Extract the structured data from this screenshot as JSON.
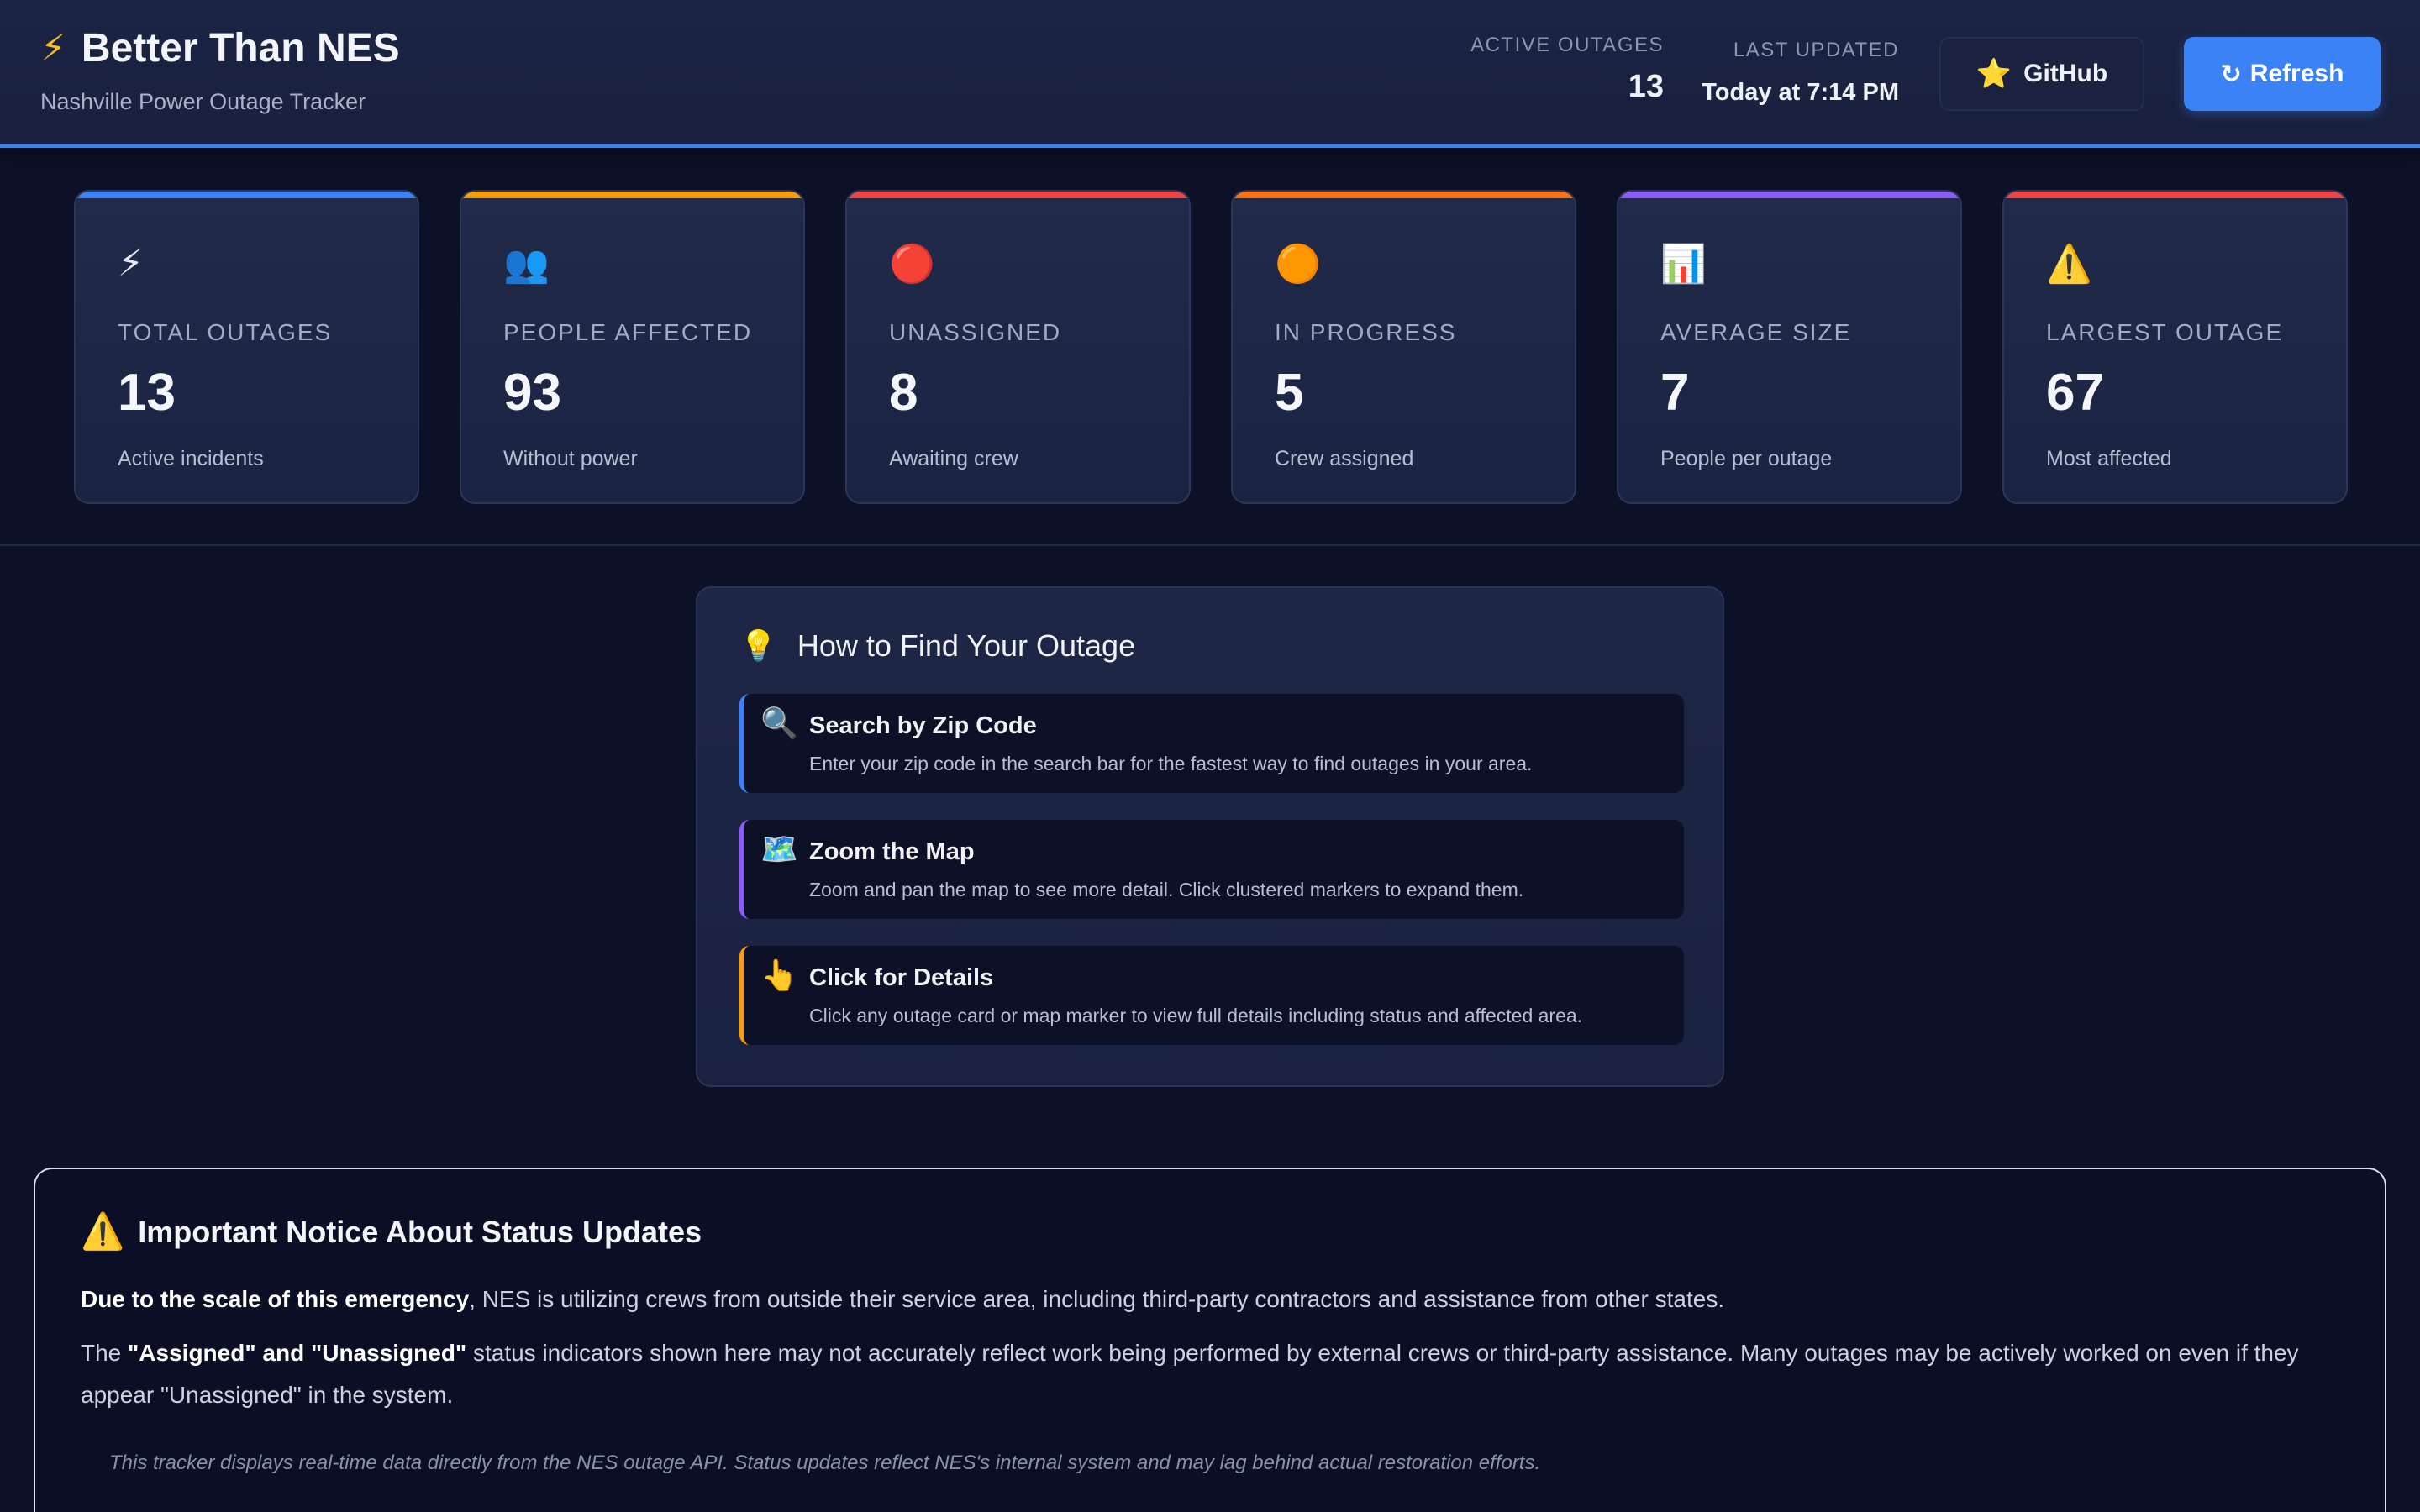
{
  "header": {
    "title": "Better Than NES",
    "title_icon": "⚡",
    "subtitle": "Nashville Power Outage Tracker",
    "active_outages_label": "ACTIVE OUTAGES",
    "active_outages_value": "13",
    "last_updated_label": "LAST UPDATED",
    "last_updated_value": "Today at 7:14 PM",
    "github_icon": "⭐",
    "github_label": "GitHub",
    "refresh_icon": "↻",
    "refresh_label": "Refresh"
  },
  "cards": [
    {
      "icon": "⚡",
      "label": "TOTAL OUTAGES",
      "value": "13",
      "sub": "Active incidents",
      "accent": "#3b82f6"
    },
    {
      "icon": "👥",
      "label": "PEOPLE AFFECTED",
      "value": "93",
      "sub": "Without power",
      "accent": "#f59e0b"
    },
    {
      "icon": "🔴",
      "label": "UNASSIGNED",
      "value": "8",
      "sub": "Awaiting crew",
      "accent": "#ef4444"
    },
    {
      "icon": "🟠",
      "label": "IN PROGRESS",
      "value": "5",
      "sub": "Crew assigned",
      "accent": "#f97316"
    },
    {
      "icon": "📊",
      "label": "AVERAGE SIZE",
      "value": "7",
      "sub": "People per outage",
      "accent": "#8b5cf6"
    },
    {
      "icon": "⚠️",
      "label": "LARGEST OUTAGE",
      "value": "67",
      "sub": "Most affected",
      "accent": "#ef4444"
    }
  ],
  "howto": {
    "icon": "💡",
    "title": "How to Find Your Outage",
    "tips": [
      {
        "icon": "🔍",
        "title": "Search by Zip Code",
        "desc": "Enter your zip code in the search bar for the fastest way to find outages in your area.",
        "accent": "#3b82f6"
      },
      {
        "icon": "🗺️",
        "title": "Zoom the Map",
        "desc": "Zoom and pan the map to see more detail. Click clustered markers to expand them.",
        "accent": "#8b5cf6"
      },
      {
        "icon": "👆",
        "title": "Click for Details",
        "desc": "Click any outage card or map marker to view full details including status and affected area.",
        "accent": "#f59e0b"
      }
    ]
  },
  "notice": {
    "icon": "⚠️",
    "title": "Important Notice About Status Updates",
    "p1_strong": "Due to the scale of this emergency",
    "p1_rest": ", NES is utilizing crews from outside their service area, including third-party contractors and assistance from other states.",
    "p2_pre": "The ",
    "p2_strong": "\"Assigned\" and \"Unassigned\"",
    "p2_rest": " status indicators shown here may not accurately reflect work being performed by external crews or third-party assistance. Many outages may be actively worked on even if they appear \"Unassigned\" in the system.",
    "footnote": "This tracker displays real-time data directly from the NES outage API. Status updates reflect NES's internal system and may lag behind actual restoration efforts."
  }
}
